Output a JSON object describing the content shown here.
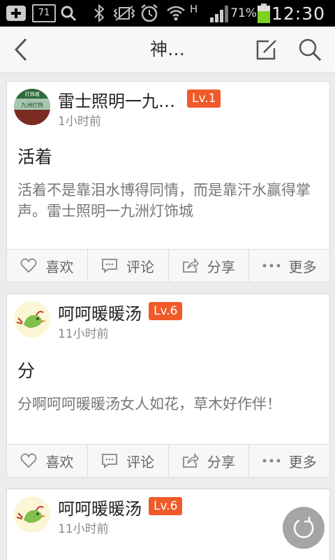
{
  "status_bar": {
    "battery": "71%",
    "time": "12:30",
    "network": "H",
    "sim_badge": "71"
  },
  "header": {
    "title": "神…"
  },
  "posts": [
    {
      "author": "雷士照明一九…",
      "level": "Lv.1",
      "time": "1小时前",
      "title": "活着",
      "body": "活着不是靠泪水博得同情，而是靠汗水赢得掌声。雷士照明一九洲灯饰城",
      "avatar_text": "九洲灯饰",
      "avatar_sign": "灯饰城"
    },
    {
      "author": "呵呵暖暖汤",
      "level": "Lv.6",
      "time": "11小时前",
      "title": "分",
      "body": "分啊呵呵暖暖汤女人如花，草木好作伴！"
    },
    {
      "author": "呵呵暖暖汤",
      "level": "Lv.6",
      "time": "11小时前"
    }
  ],
  "actions": {
    "like": "喜欢",
    "comment": "评论",
    "share": "分享",
    "more": "更多"
  },
  "colors": {
    "level_badge": "#f05a28",
    "status_bar": "#000000",
    "battery": "#7ed321"
  }
}
